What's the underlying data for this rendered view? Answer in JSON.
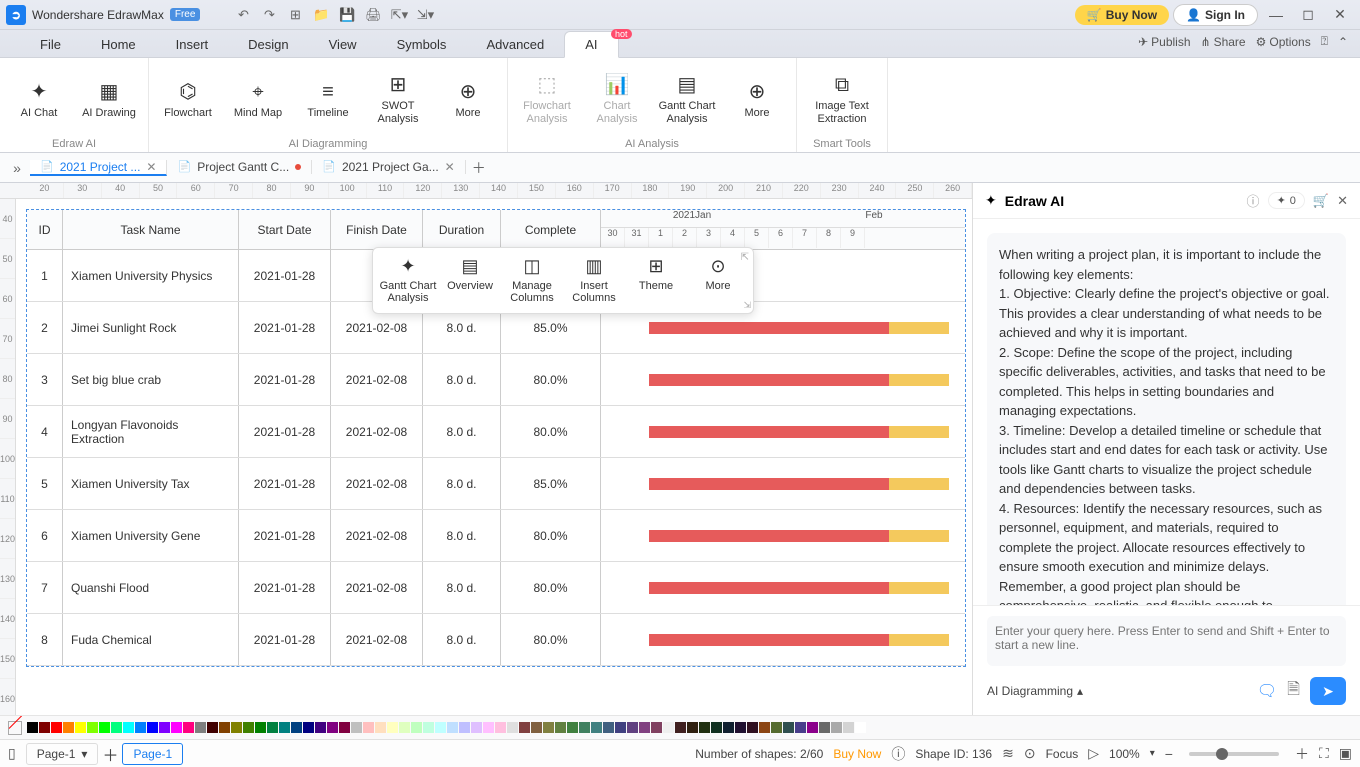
{
  "app": {
    "name": "Wondershare EdrawMax",
    "edition": "Free"
  },
  "titlebar": {
    "buy": "Buy Now",
    "signin": "Sign In"
  },
  "menu": {
    "items": [
      "File",
      "Home",
      "Insert",
      "Design",
      "View",
      "Symbols",
      "Advanced"
    ],
    "ai": "AI",
    "hot": "hot",
    "publish": "Publish",
    "share": "Share",
    "options": "Options"
  },
  "ribbon": {
    "g1": {
      "ai_chat": "AI Chat",
      "ai_drawing": "AI Drawing",
      "label": "Edraw AI"
    },
    "g2": {
      "flowchart": "Flowchart",
      "mindmap": "Mind Map",
      "timeline": "Timeline",
      "swot": "SWOT Analysis",
      "more": "More",
      "label": "AI Diagramming"
    },
    "g3": {
      "flowchart_analysis": "Flowchart Analysis",
      "chart_analysis": "Chart Analysis",
      "gantt_analysis": "Gantt Chart Analysis",
      "more": "More",
      "label": "AI Analysis"
    },
    "g4": {
      "img_text": "Image Text Extraction",
      "label": "Smart Tools"
    }
  },
  "tabs": [
    {
      "label": "2021 Project ...",
      "active": true,
      "close": true
    },
    {
      "label": "Project Gantt C...",
      "modified": true
    },
    {
      "label": "2021 Project Ga...",
      "close": true
    }
  ],
  "hruler": [
    "20",
    "30",
    "40",
    "50",
    "60",
    "70",
    "80",
    "90",
    "100",
    "110",
    "120",
    "130",
    "140",
    "150",
    "160",
    "170",
    "180",
    "190",
    "200",
    "210",
    "220",
    "230",
    "240",
    "250",
    "260"
  ],
  "vruler": [
    "40",
    "50",
    "60",
    "70",
    "80",
    "90",
    "100",
    "110",
    "120",
    "130",
    "140",
    "150",
    "160"
  ],
  "gantt": {
    "cols": {
      "id": "ID",
      "task": "Task Name",
      "start": "Start Date",
      "finish": "Finish Date",
      "duration": "Duration",
      "complete": "Complete"
    },
    "months": [
      "2021Jan",
      "Feb"
    ],
    "days": [
      "30",
      "31",
      "1",
      "2",
      "3",
      "4",
      "5",
      "6",
      "7",
      "8",
      "9"
    ],
    "rows": [
      {
        "id": "1",
        "task": "Xiamen University Physics",
        "start": "2021-01-28",
        "finish": "",
        "duration": "",
        "complete": ""
      },
      {
        "id": "2",
        "task": "Jimei Sunlight Rock",
        "start": "2021-01-28",
        "finish": "2021-02-08",
        "duration": "8.0 d.",
        "complete": "85.0%"
      },
      {
        "id": "3",
        "task": "Set big blue crab",
        "start": "2021-01-28",
        "finish": "2021-02-08",
        "duration": "8.0 d.",
        "complete": "80.0%"
      },
      {
        "id": "4",
        "task": "Longyan Flavonoids Extraction",
        "start": "2021-01-28",
        "finish": "2021-02-08",
        "duration": "8.0 d.",
        "complete": "80.0%"
      },
      {
        "id": "5",
        "task": "Xiamen University Tax",
        "start": "2021-01-28",
        "finish": "2021-02-08",
        "duration": "8.0 d.",
        "complete": "85.0%"
      },
      {
        "id": "6",
        "task": "Xiamen University Gene",
        "start": "2021-01-28",
        "finish": "2021-02-08",
        "duration": "8.0 d.",
        "complete": "80.0%"
      },
      {
        "id": "7",
        "task": "Quanshi Flood",
        "start": "2021-01-28",
        "finish": "2021-02-08",
        "duration": "8.0 d.",
        "complete": "80.0%"
      },
      {
        "id": "8",
        "task": "Fuda Chemical",
        "start": "2021-01-28",
        "finish": "2021-02-08",
        "duration": "8.0 d.",
        "complete": "80.0%"
      }
    ]
  },
  "float": {
    "gantt": "Gantt Chart Analysis",
    "overview": "Overview",
    "manage": "Manage Columns",
    "insert": "Insert Columns",
    "theme": "Theme",
    "more": "More"
  },
  "ai": {
    "title": "Edraw AI",
    "tokens": "0",
    "message": "When writing a project plan, it is important to include the following key elements:\n1. Objective: Clearly define the project's objective or goal. This provides a clear understanding of what needs to be achieved and why it is important.\n2. Scope: Define the scope of the project, including specific deliverables, activities, and tasks that need to be completed. This helps in setting boundaries and managing expectations.\n3. Timeline: Develop a detailed timeline or schedule that includes start and end dates for each task or activity. Use tools like Gantt charts to visualize the project schedule and dependencies between tasks.\n4. Resources: Identify the necessary resources, such as personnel, equipment, and materials, required to complete the project. Allocate resources effectively to ensure smooth execution and minimize delays.\nRemember, a good project plan should be comprehensive, realistic, and flexible enough to accommodate changes as the project progresses. Regularly review and update the plan to ensure its effectiveness and alignment with project goals.",
    "action": "AI Diagramming",
    "placeholder": "Enter your query here. Press Enter to send and Shift + Enter to start a new line.",
    "footer_action": "AI Diagramming"
  },
  "colors": [
    "#000000",
    "#7f0000",
    "#ff0000",
    "#ff7f00",
    "#ffff00",
    "#7fff00",
    "#00ff00",
    "#00ff7f",
    "#00ffff",
    "#007fff",
    "#0000ff",
    "#7f00ff",
    "#ff00ff",
    "#ff007f",
    "#7f7f7f",
    "#400000",
    "#804000",
    "#808000",
    "#408000",
    "#008000",
    "#008040",
    "#008080",
    "#004080",
    "#000080",
    "#400080",
    "#800080",
    "#800040",
    "#bfbfbf",
    "#ffbfbf",
    "#ffdfbf",
    "#ffffbf",
    "#dfffbf",
    "#bfffbf",
    "#bfffdf",
    "#bfffff",
    "#bfdfff",
    "#bfbfff",
    "#dfbfff",
    "#ffbfff",
    "#ffbfdf",
    "#dfdfdf",
    "#804040",
    "#806040",
    "#808040",
    "#608040",
    "#408040",
    "#408060",
    "#408080",
    "#406080",
    "#404080",
    "#604080",
    "#804080",
    "#804060",
    "#efefef",
    "#402020",
    "#302010",
    "#203010",
    "#103020",
    "#102030",
    "#201030",
    "#301020",
    "#8b4513",
    "#556b2f",
    "#2f4f4f",
    "#483d8b",
    "#8b008b",
    "#696969",
    "#a9a9a9",
    "#d3d3d3",
    "#ffffff"
  ],
  "status": {
    "page_sel": "Page-1",
    "page_active": "Page-1",
    "shapes": "Number of shapes: 2/60",
    "buy": "Buy Now",
    "shape_id": "Shape ID: 136",
    "focus": "Focus",
    "zoom": "100%"
  }
}
